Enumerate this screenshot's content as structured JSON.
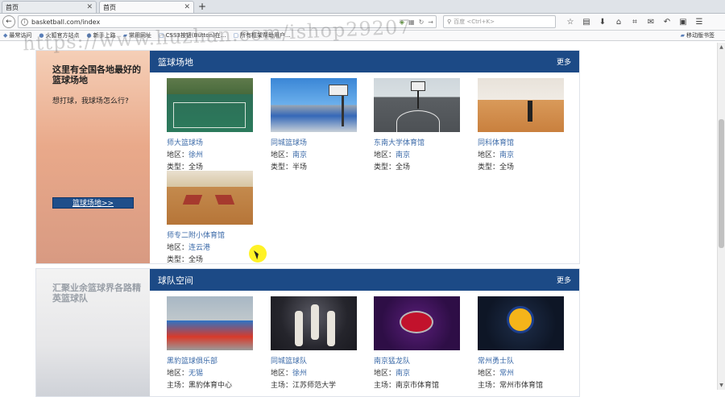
{
  "browser": {
    "tabs": [
      {
        "label": "首页",
        "active": false
      },
      {
        "label": "首页",
        "active": true
      }
    ],
    "url": "basketball.com/index",
    "search_placeholder": "百度 <Ctrl+K>",
    "bookmarks": [
      "最常访问",
      "火狐官方站点",
      "新手上路",
      "常用网址",
      "CSS3按钮(Button)在...",
      "所有框架帮助用户..."
    ],
    "bookmarks_right": "移动版书签"
  },
  "sections": [
    {
      "side_title": "这里有全国各地最好的篮球场地",
      "side_sub": "想打球，我球场怎么行?",
      "side_button": "篮球场地>>",
      "header_title": "篮球场地",
      "header_more": "更多",
      "cards": [
        {
          "name": "师大篮球场",
          "region_label": "地区：",
          "region": "徐州",
          "type_label": "类型：",
          "type": "全场"
        },
        {
          "name": "同城篮球场",
          "region_label": "地区：",
          "region": "南京",
          "type_label": "类型：",
          "type": "半场"
        },
        {
          "name": "东南大学体育馆",
          "region_label": "地区：",
          "region": "南京",
          "type_label": "类型：",
          "type": "全场"
        },
        {
          "name": "同科体育馆",
          "region_label": "地区：",
          "region": "南京",
          "type_label": "类型：",
          "type": "全场"
        },
        {
          "name": "师专二附小体育馆",
          "region_label": "地区：",
          "region": "连云港",
          "type_label": "类型：",
          "type": "全场"
        }
      ]
    },
    {
      "side_title": "汇聚业余篮球界各路精英篮球队",
      "header_title": "球队空间",
      "header_more": "更多",
      "cards": [
        {
          "name": "黑豹篮球俱乐部",
          "region_label": "地区：",
          "region": "无锡",
          "home_label": "主场：",
          "home": "黑豹体育中心"
        },
        {
          "name": "同城篮球队",
          "region_label": "地区：",
          "region": "徐州",
          "home_label": "主场：",
          "home": "江苏师范大学"
        },
        {
          "name": "南京猛龙队",
          "region_label": "地区：",
          "region": "南京",
          "home_label": "主场：",
          "home": "南京市体育馆"
        },
        {
          "name": "常州勇士队",
          "region_label": "地区：",
          "region": "常州",
          "home_label": "主场：",
          "home": "常州市体育馆"
        }
      ]
    }
  ],
  "watermark": "https://www.huzhan.com/ishop29207",
  "colors": {
    "header": "#1c4a86",
    "link": "#3b6aa8"
  }
}
